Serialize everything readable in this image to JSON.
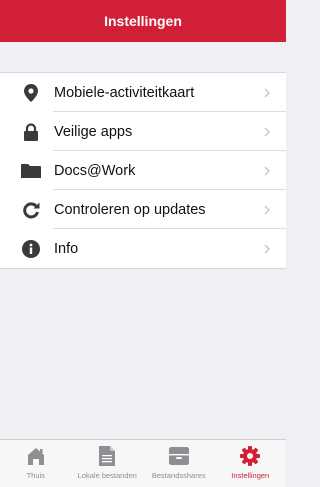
{
  "header": {
    "title": "Instellingen"
  },
  "settings": {
    "items": [
      {
        "label": "Mobiele-activiteitkaart",
        "icon": "location-pin-icon"
      },
      {
        "label": "Veilige apps",
        "icon": "lock-icon"
      },
      {
        "label": "Docs@Work",
        "icon": "folder-icon"
      },
      {
        "label": "Controleren op updates",
        "icon": "refresh-icon"
      },
      {
        "label": "Info",
        "icon": "info-icon"
      }
    ]
  },
  "tabbar": {
    "tabs": [
      {
        "label": "Thuis",
        "icon": "home-icon"
      },
      {
        "label": "Lokale bestanden",
        "icon": "document-icon"
      },
      {
        "label": "Bestandsshares",
        "icon": "archive-box-icon"
      },
      {
        "label": "Instellingen",
        "icon": "gear-icon",
        "active": true
      }
    ]
  },
  "colors": {
    "brand": "#d01f36",
    "icon_gray": "#3a3a3c",
    "background": "#efeff4"
  }
}
